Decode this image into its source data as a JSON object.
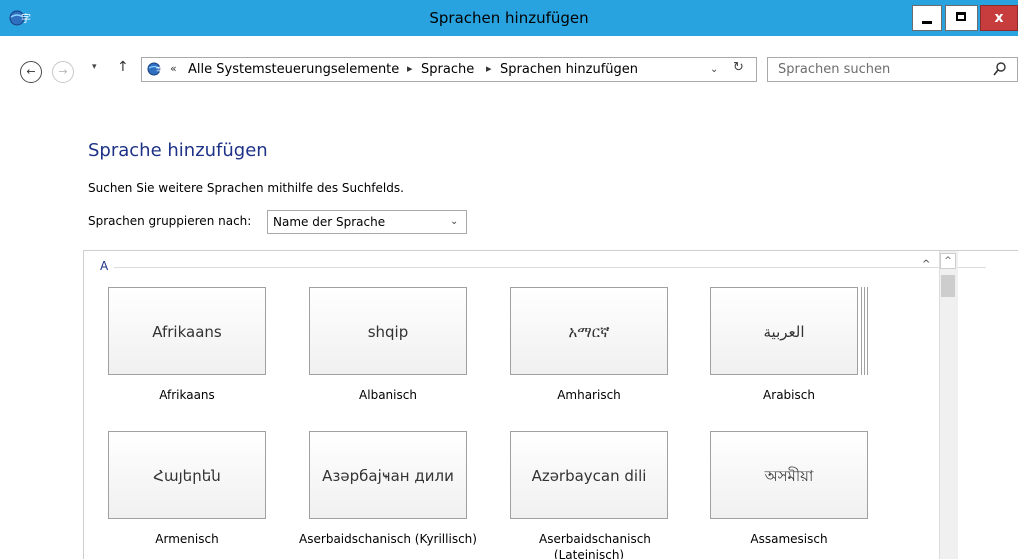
{
  "window": {
    "title": "Sprachen hinzufügen",
    "close_glyph": "x"
  },
  "nav": {
    "back_glyph": "←",
    "forward_glyph": "→",
    "recent_glyph": "▾",
    "up_glyph": "↑"
  },
  "address": {
    "overflow": "«",
    "separator": "▸",
    "crumbs": [
      "Alle Systemsteuerungselemente",
      "Sprache",
      "Sprachen hinzufügen"
    ],
    "dropdown_glyph": "⌄",
    "refresh_glyph": "↻"
  },
  "search": {
    "placeholder": "Sprachen suchen"
  },
  "page": {
    "heading": "Sprache hinzufügen",
    "help": "Suchen Sie weitere Sprachen mithilfe des Suchfelds.",
    "group_label": "Sprachen gruppieren nach:",
    "group_value": "Name der Sprache"
  },
  "list": {
    "group_letter": "A",
    "languages": [
      {
        "native": "Afrikaans",
        "name": "Afrikaans"
      },
      {
        "native": "shqip",
        "name": "Albanisch"
      },
      {
        "native": "አማርኛ",
        "name": "Amharisch"
      },
      {
        "native": "العربية",
        "name": "Arabisch"
      },
      {
        "native": "Հայերեն",
        "name": "Armenisch"
      },
      {
        "native": "Азәрбајҹан дили",
        "name": "Aserbaidschanisch (Kyrillisch)"
      },
      {
        "native": "Azərbaycan dili",
        "name": "Aserbaidschanisch (Lateinisch)"
      },
      {
        "native": "অসমীয়া",
        "name": "Assamesisch"
      }
    ]
  },
  "colors": {
    "titlebar": "#28a3e0",
    "close_button": "#c73d3d",
    "heading": "#1e3287"
  }
}
